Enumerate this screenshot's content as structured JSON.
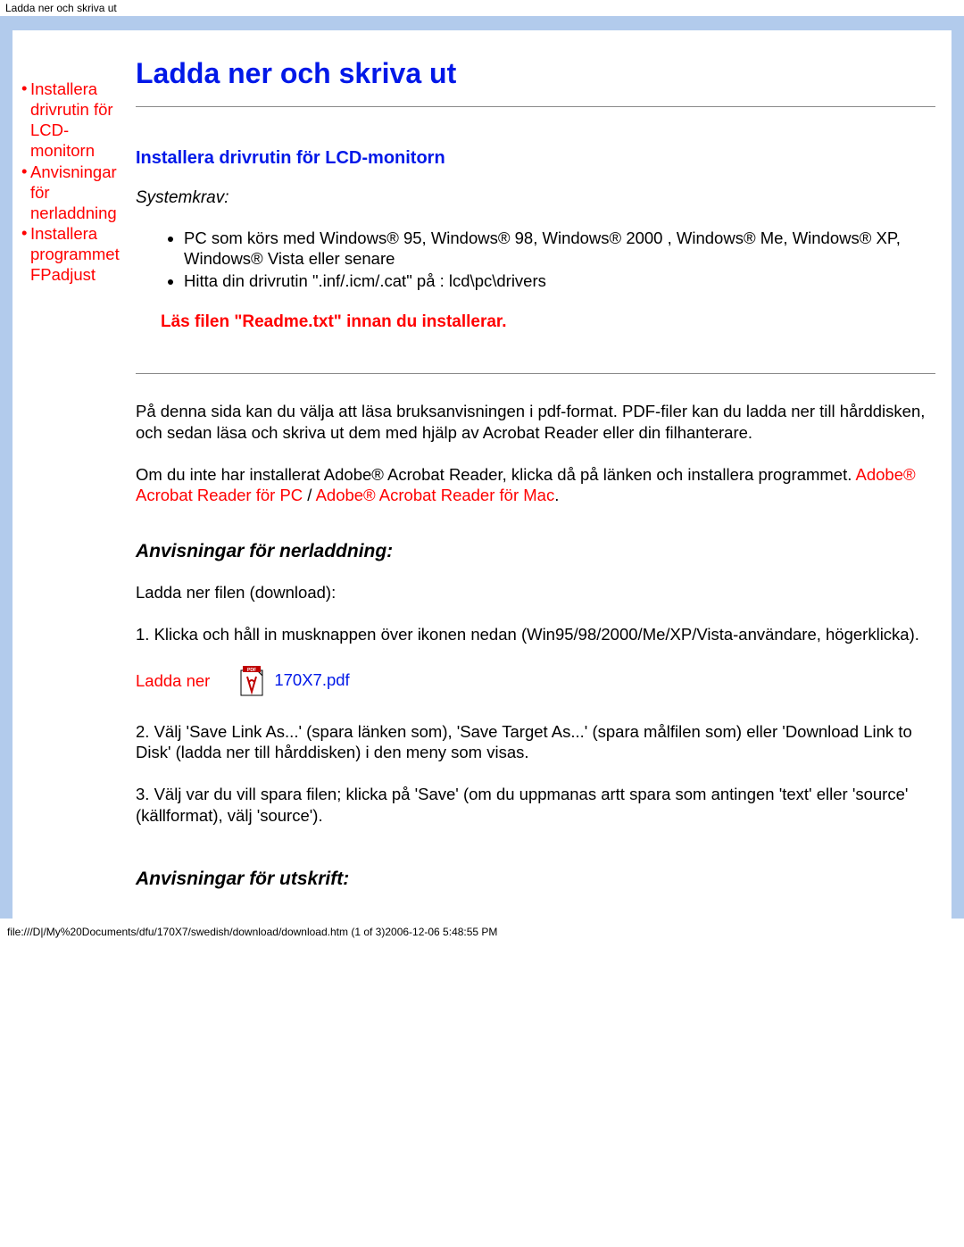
{
  "header_text": "Ladda ner och skriva ut",
  "nav": {
    "items": [
      {
        "bullet": "•",
        "label": "Installera drivrutin för LCD-monitorn"
      },
      {
        "bullet": "•",
        "label": "Anvisningar för nerladdning"
      },
      {
        "bullet": "",
        "label": "Installera programmet FPadjust"
      }
    ],
    "bullet3": "•"
  },
  "title": "Ladda ner och skriva ut",
  "section1": {
    "heading": "Installera drivrutin för LCD-monitorn",
    "subhead": "Systemkrav:",
    "bullets": [
      "PC som körs med Windows® 95, Windows® 98, Windows® 2000 , Windows® Me, Windows® XP, Windows® Vista eller senare",
      "Hitta din drivrutin \".inf/.icm/.cat\" på : lcd\\pc\\drivers"
    ],
    "warning": "Läs filen \"Readme.txt\" innan du installerar."
  },
  "middle": {
    "p1": "På denna sida kan du välja att läsa bruksanvisningen i pdf-format. PDF-filer kan du ladda ner till hårddisken, och sedan läsa och skriva ut dem med hjälp av Acrobat Reader eller din filhanterare.",
    "p2a": "Om du inte har installerat Adobe® Acrobat Reader, klicka då på länken och installera programmet. ",
    "link_pc": "Adobe® Acrobat Reader för PC",
    "sep": " / ",
    "link_mac": "Adobe® Acrobat Reader för Mac",
    "period": "."
  },
  "download": {
    "heading": "Anvisningar för nerladdning:",
    "p1": "Ladda ner filen (download):",
    "p2": "1. Klicka och håll in musknappen över ikonen nedan (Win95/98/2000/Me/XP/Vista-användare, högerklicka).",
    "label": "Ladda ner",
    "pdf_name": "170X7.pdf",
    "p3": "2. Välj 'Save Link As...' (spara länken som), 'Save Target As...' (spara målfilen som) eller 'Download Link to Disk' (ladda ner till hårddisken) i den meny som visas.",
    "p4": "3. Välj var du vill spara filen; klicka på 'Save' (om du uppmanas artt spara som antingen 'text' eller 'source' (källformat), välj 'source')."
  },
  "print": {
    "heading": "Anvisningar för utskrift:"
  },
  "footer_text": "file:///D|/My%20Documents/dfu/170X7/swedish/download/download.htm (1 of 3)2006-12-06 5:48:55 PM"
}
